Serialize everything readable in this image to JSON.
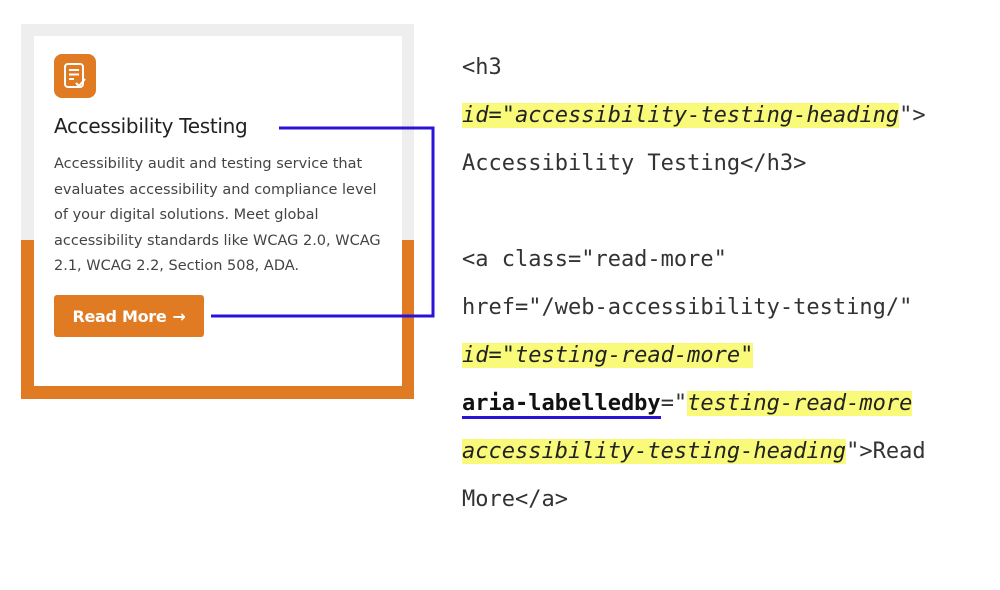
{
  "card": {
    "title": "Accessibility Testing",
    "description": "Accessibility audit and testing service that evaluates accessibility and compliance level of your digital solutions. Meet global accessibility standards like WCAG 2.0, WCAG 2.1, WCAG 2.2, Section 508, ADA.",
    "button_label": "Read More",
    "button_arrow": "→",
    "icon": "checklist-icon"
  },
  "code": {
    "l1": "<h3",
    "l2_attr": "id=\"accessibility-testing-heading",
    "l2_tail": "\">",
    "l3": "Accessibility Testing</h3>",
    "l5": "<a class=\"read-more\"",
    "l6": "href=\"/web-accessibility-testing/\"",
    "l7_attr": "id=\"testing-read-more\"",
    "l8_attr": "aria-labelledby",
    "l8_eq": "=\"",
    "l8_val": "testing-read-more",
    "l9_val": "accessibility-testing-heading",
    "l9_tail": "\">Read",
    "l10": "More</a>"
  },
  "colors": {
    "accent": "#e07b24",
    "highlight": "#fafa7a",
    "connector": "#2a12d9"
  }
}
